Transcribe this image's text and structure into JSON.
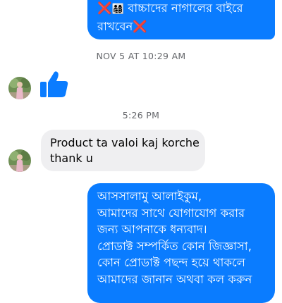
{
  "messages": {
    "outgoing_top": {
      "lines": [
        "বাচ্চাদের নাগালের বাইরে",
        "রাখবেন"
      ],
      "emoji": {
        "cross": "❌",
        "family": "👨‍👩‍👧‍👦"
      }
    },
    "timestamp_1": "NOV 5 AT 10:29 AM",
    "like": "👍",
    "timestamp_2": "5:26 PM",
    "incoming": {
      "lines": [
        "Product ta valoi kaj korche",
        "thank u"
      ]
    },
    "outgoing_bottom": {
      "lines": [
        "আসসালামু আলাইকুম,",
        "আমাদের সাথে যোগাযোগ করার",
        "জন্য আপনাকে  ধন্যবাদ।",
        "প্রোডাক্ট সম্পর্কিত কোন জিজ্ঞাসা,",
        "কোন প্রোডাক্ট পছন্দ হয়ে থাকলে",
        "আমাদের জানান অথবা কল করুন"
      ]
    }
  },
  "colors": {
    "outgoing_bubble": "#0a7cff",
    "incoming_bubble": "#efeff1",
    "like_icon": "#0a7cff",
    "timestamp_text": "#65676b"
  },
  "icons": {
    "like": "thumbs-up-icon",
    "avatar": "user-avatar"
  }
}
